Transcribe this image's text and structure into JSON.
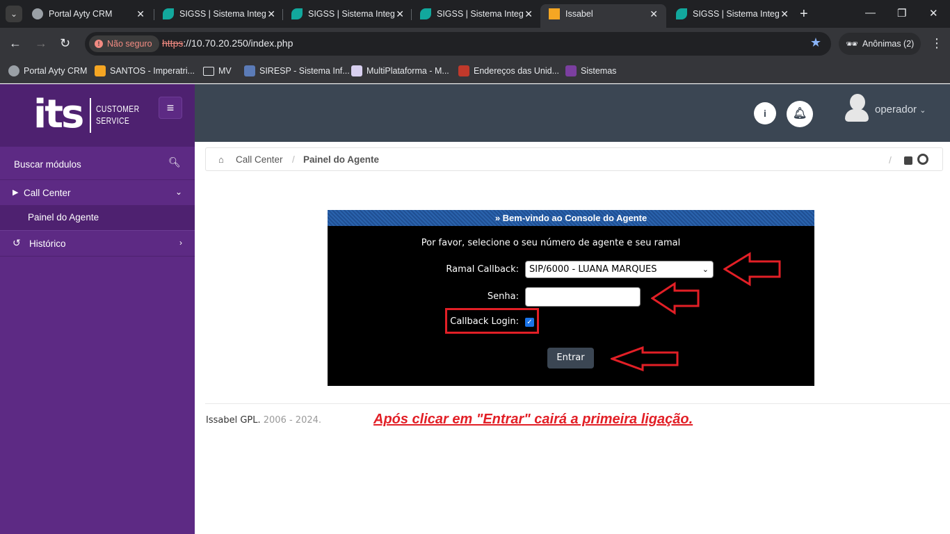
{
  "browser": {
    "tabs": [
      {
        "title": "Portal Ayty CRM",
        "active": false
      },
      {
        "title": "SIGSS | Sistema Integrado",
        "active": false
      },
      {
        "title": "SIGSS | Sistema Integrado",
        "active": false
      },
      {
        "title": "SIGSS | Sistema Integrado",
        "active": false
      },
      {
        "title": "Issabel",
        "active": true
      },
      {
        "title": "SIGSS | Sistema Integrado",
        "active": false
      }
    ],
    "security_label": "Não seguro",
    "url_scheme": "https",
    "url_rest": "://10.70.20.250/index.php",
    "incognito_label": "Anônimas (2)",
    "bookmarks": [
      "Portal Ayty CRM",
      "SANTOS - Imperatri...",
      "MV",
      "SIRESP - Sistema Inf...",
      "MultiPlataforma - M...",
      "Endereços das Unid...",
      "Sistemas"
    ]
  },
  "logo": {
    "text": "its",
    "line1": "CUSTOMER",
    "line2": "SERVICE"
  },
  "sidebar": {
    "search_label": "Buscar módulos",
    "items": [
      {
        "label": "Call Center"
      },
      {
        "label": "Painel do Agente"
      },
      {
        "label": "Histórico"
      }
    ]
  },
  "topbar": {
    "user": "operador"
  },
  "breadcrumb": {
    "level1": "Call Center",
    "separator": "/",
    "level2": "Painel do Agente",
    "right_sep": "/"
  },
  "console": {
    "header": "» Bem-vindo ao Console do Agente",
    "instruction": "Por favor, selecione o seu número de agente e seu ramal",
    "ramal_label": "Ramal Callback:",
    "ramal_value": "SIP/6000 - LUANA MARQUES",
    "senha_label": "Senha:",
    "senha_value": "",
    "callback_label": "Callback Login:",
    "callback_checked": true,
    "submit_label": "Entrar"
  },
  "footer": {
    "brand": "Issabel GPL",
    "years": "2006 - 2024."
  },
  "annotation": "Após clicar em \"Entrar\" cairá a primeira ligação.",
  "colors": {
    "sidebar": "#5d2a84",
    "topbar": "#3b4653",
    "annotation": "#e21f26",
    "console_header": "#2a63ad"
  }
}
